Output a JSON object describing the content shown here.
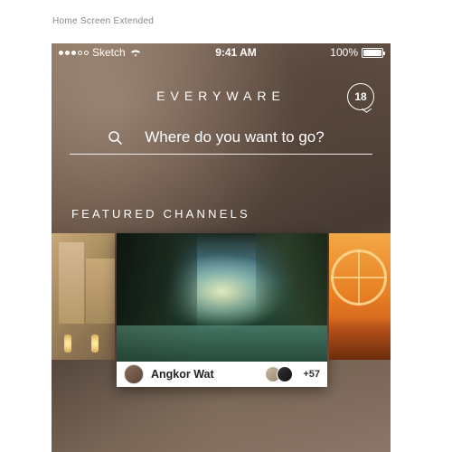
{
  "page_label": "Home Screen Extended",
  "status": {
    "carrier": "Sketch",
    "time": "9:41 AM",
    "battery_pct": "100%"
  },
  "header": {
    "brand": "EVERYWARE",
    "notification_count": "18"
  },
  "search": {
    "placeholder": "Where do you want to go?"
  },
  "section": {
    "title": "FEATURED CHANNELS"
  },
  "featured": {
    "title": "Angkor Wat",
    "extra_count": "+57"
  }
}
